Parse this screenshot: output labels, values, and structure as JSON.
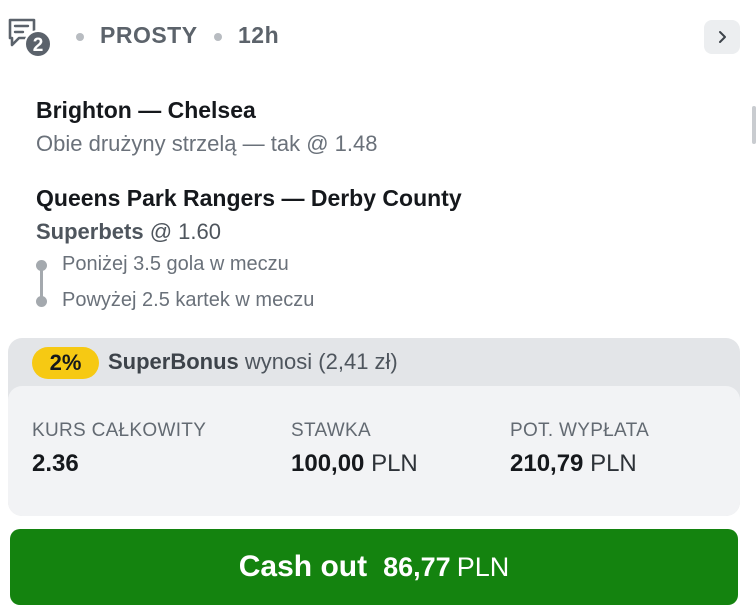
{
  "header": {
    "bet_icon": "bet-slip-icon",
    "bet_count": "2",
    "bet_type": "PROSTY",
    "time": "12h",
    "expand_icon": "chevron-right-icon"
  },
  "bets": [
    {
      "match": "Brighton — Chelsea",
      "selection": "Obie drużyny strzelą — tak @ 1.48"
    },
    {
      "match": "Queens Park Rangers — Derby County",
      "superbet_name": "Superbets",
      "superbet_odds": "@ 1.60",
      "legs": [
        "Poniżej 3.5 gola w meczu",
        "Powyżej 2.5 kartek w meczu"
      ]
    }
  ],
  "bonus": {
    "percent": "2%",
    "name": "SuperBonus",
    "text": "wynosi (2,41 zł)"
  },
  "summary": {
    "total_odds_label": "KURS CAŁKOWITY",
    "total_odds_value": "2.36",
    "stake_label": "STAWKA",
    "stake_value": "100,00",
    "stake_unit": "PLN",
    "payout_label": "POT. WYPŁATA",
    "payout_value": "210,79",
    "payout_unit": "PLN"
  },
  "cashout": {
    "label": "Cash out",
    "amount": "86,77",
    "unit": "PLN"
  },
  "colors": {
    "cashout_green": "#14830f",
    "bonus_yellow": "#f6c913",
    "panel_gray": "#e3e5e8"
  }
}
